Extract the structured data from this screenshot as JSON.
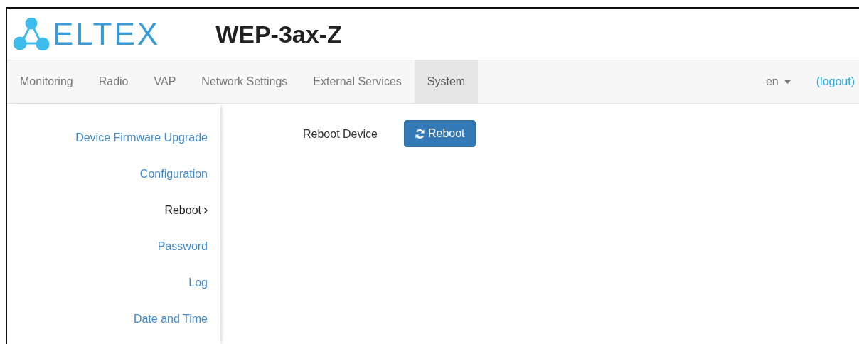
{
  "header": {
    "logo_text": "ELTEX",
    "model": "WEP-3ax-Z"
  },
  "nav": {
    "tabs": [
      {
        "label": "Monitoring",
        "selected": false
      },
      {
        "label": "Radio",
        "selected": false
      },
      {
        "label": "VAP",
        "selected": false
      },
      {
        "label": "Network Settings",
        "selected": false
      },
      {
        "label": "External Services",
        "selected": false
      },
      {
        "label": "System",
        "selected": true
      }
    ],
    "language": "en",
    "logout": "(logout)"
  },
  "sidebar": {
    "items": [
      {
        "label": "Device Firmware Upgrade",
        "selected": false
      },
      {
        "label": "Configuration",
        "selected": false
      },
      {
        "label": "Reboot",
        "selected": true
      },
      {
        "label": "Password",
        "selected": false
      },
      {
        "label": "Log",
        "selected": false
      },
      {
        "label": "Date and Time",
        "selected": false
      }
    ]
  },
  "content": {
    "label": "Reboot Device",
    "button": "Reboot"
  }
}
